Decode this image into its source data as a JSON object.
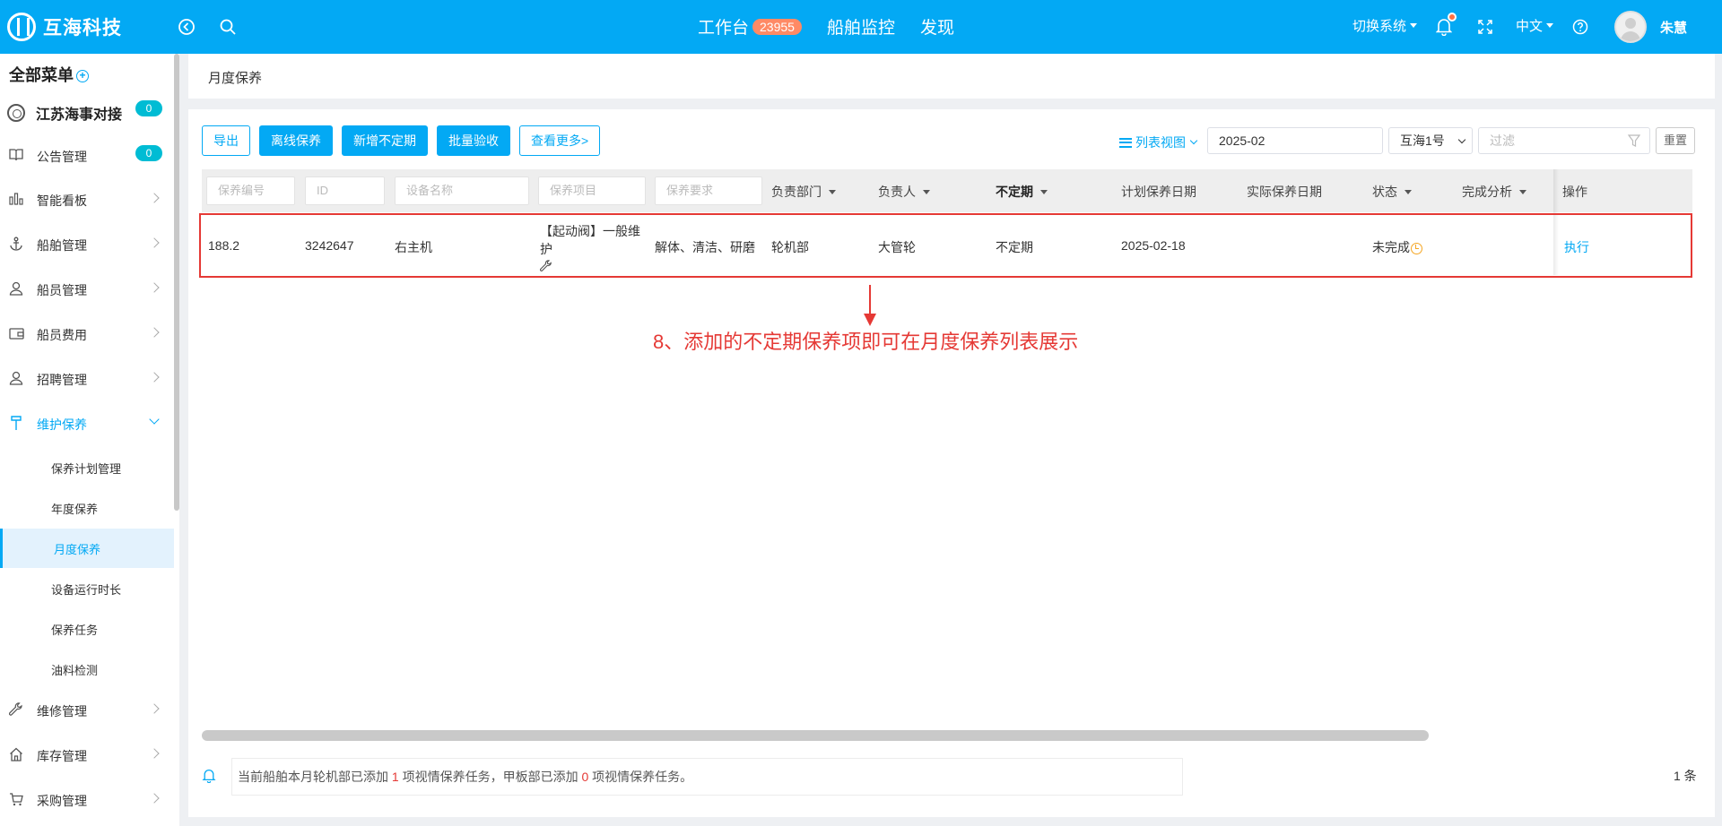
{
  "topbar": {
    "brand": "互海科技",
    "nav": [
      {
        "label": "工作台",
        "badge": "23955"
      },
      {
        "label": "船舶监控"
      },
      {
        "label": "发现"
      }
    ],
    "switch_system": "切换系统",
    "language": "中文",
    "username": "朱慧"
  },
  "sidebar": {
    "title": "全部菜单",
    "company": "江苏海事对接",
    "company_badge": "0",
    "items": [
      {
        "label": "公告管理",
        "icon": "book-icon",
        "badge": "0"
      },
      {
        "label": "智能看板",
        "icon": "bar-chart-icon"
      },
      {
        "label": "船舶管理",
        "icon": "anchor-icon"
      },
      {
        "label": "船员管理",
        "icon": "person-icon"
      },
      {
        "label": "船员费用",
        "icon": "wallet-icon"
      },
      {
        "label": "招聘管理",
        "icon": "person-icon"
      },
      {
        "label": "维护保养",
        "icon": "tool-icon",
        "open": true
      },
      {
        "label": "维修管理",
        "icon": "wrench-icon"
      },
      {
        "label": "库存管理",
        "icon": "home-icon"
      },
      {
        "label": "采购管理",
        "icon": "cart-icon"
      }
    ],
    "subitems": [
      "保养计划管理",
      "年度保养",
      "月度保养",
      "设备运行时长",
      "保养任务",
      "油料检测"
    ],
    "active_sub": "月度保养"
  },
  "breadcrumb": "月度保养",
  "toolbar": {
    "export": "导出",
    "offline": "离线保养",
    "add_irregular": "新增不定期",
    "batch_accept": "批量验收",
    "more": "查看更多>",
    "list_view": "列表视图",
    "month": "2025-02",
    "vessel": "互海1号",
    "filter_placeholder": "过滤",
    "reset": "重置"
  },
  "table": {
    "header_inputs": [
      "保养编号",
      "ID",
      "设备名称",
      "保养项目",
      "保养要求"
    ],
    "header_labels": {
      "dept": "负责部门",
      "person": "负责人",
      "irregular": "不定期",
      "plan_date": "计划保养日期",
      "actual_date": "实际保养日期",
      "status": "状态",
      "analysis": "完成分析",
      "ops": "操作"
    },
    "rows": [
      {
        "code": "188.2",
        "id": "3242647",
        "device": "右主机",
        "item": "【起动阀】一般维护",
        "requirement": "解体、清洁、研磨",
        "dept": "轮机部",
        "person": "大管轮",
        "irregular": "不定期",
        "plan_date": "2025-02-18",
        "actual_date": "",
        "status": "未完成",
        "analysis": "",
        "action": "执行"
      }
    ]
  },
  "annotation": "8、添加的不定期保养项即可在月度保养列表展示",
  "footer": {
    "notice_prefix": "当前船舶本月轮机部已添加",
    "engine_count": "1",
    "notice_mid": "项视情保养任务，甲板部已添加",
    "deck_count": "0",
    "notice_suffix": "项视情保养任务。",
    "total": "1 条"
  }
}
